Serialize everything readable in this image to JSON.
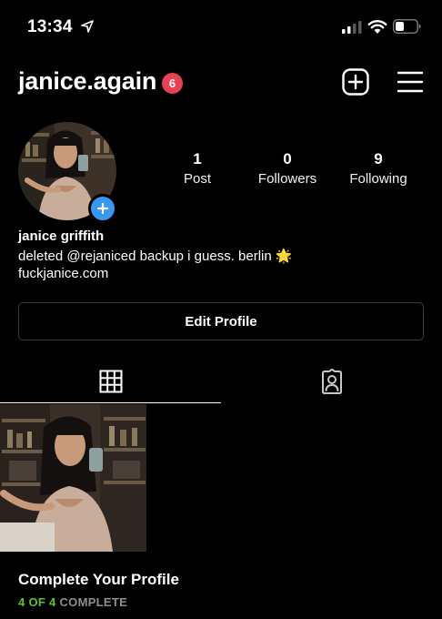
{
  "status_bar": {
    "time": "13:34"
  },
  "header": {
    "username": "janice.again",
    "notification_count": "6"
  },
  "profile": {
    "stats": [
      {
        "value": "1",
        "label": "Post"
      },
      {
        "value": "0",
        "label": "Followers"
      },
      {
        "value": "9",
        "label": "Following"
      }
    ],
    "full_name": "janice griffith",
    "bio": "deleted @rejaniced backup i guess. berlin 🌟",
    "link": "fuckjanice.com",
    "edit_label": "Edit Profile"
  },
  "tabs": [
    {
      "name": "grid",
      "icon": "grid-icon",
      "active": true
    },
    {
      "name": "tagged",
      "icon": "tagged-person-icon",
      "active": false
    }
  ],
  "complete_profile": {
    "title": "Complete Your Profile",
    "progress_count": "4 OF 4",
    "progress_label": "COMPLETE"
  },
  "colors": {
    "badge": "#e94052",
    "accent_blue": "#3897f0",
    "success_green": "#58c322"
  }
}
